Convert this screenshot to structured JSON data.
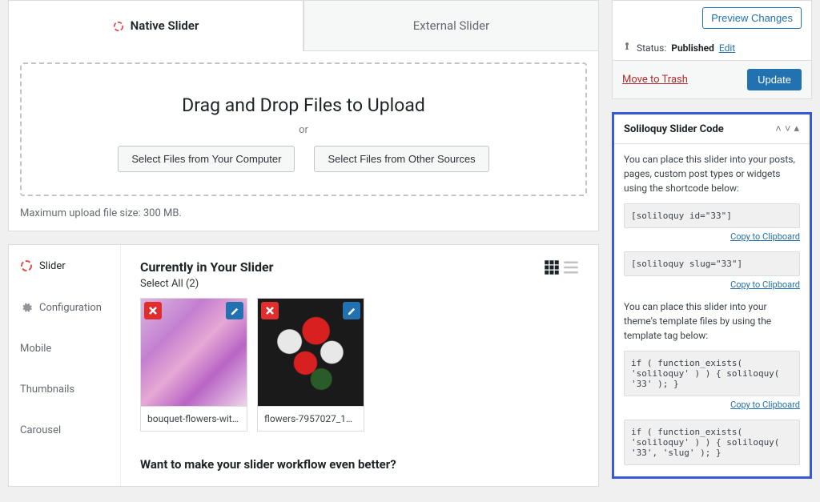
{
  "tabs": {
    "native": "Native Slider",
    "external": "External Slider"
  },
  "dropzone": {
    "title": "Drag and Drop Files to Upload",
    "or": "or",
    "btn_computer": "Select Files from Your Computer",
    "btn_other": "Select Files from Other Sources",
    "note": "Maximum upload file size: 300 MB."
  },
  "nav": {
    "slider": "Slider",
    "configuration": "Configuration",
    "mobile": "Mobile",
    "thumbnails": "Thumbnails",
    "carousel": "Carousel"
  },
  "content": {
    "heading": "Currently in Your Slider",
    "select_all": "Select All (2)",
    "items": [
      {
        "label": "bouquet-flowers-with..."
      },
      {
        "label": "flowers-7957027_1280"
      }
    ],
    "promo": "Want to make your slider workflow even better?"
  },
  "publish": {
    "preview": "Preview Changes",
    "status_label": "Status:",
    "status_value": "Published",
    "edit": "Edit",
    "trash": "Move to Trash",
    "update": "Update"
  },
  "codebox": {
    "title": "Soliloquy Slider Code",
    "desc1": "You can place this slider into your posts, pages, custom post types or widgets using the shortcode below:",
    "sc1": "[soliloquy id=\"33\"]",
    "sc2": "[soliloquy slug=\"33\"]",
    "desc2": "You can place this slider into your theme's template files by using the template tag below:",
    "php1": "if ( function_exists( 'soliloquy' ) ) { soliloquy( '33' ); }",
    "php2": "if ( function_exists( 'soliloquy' ) ) { soliloquy( '33', 'slug' ); }",
    "copy": "Copy to Clipboard"
  }
}
